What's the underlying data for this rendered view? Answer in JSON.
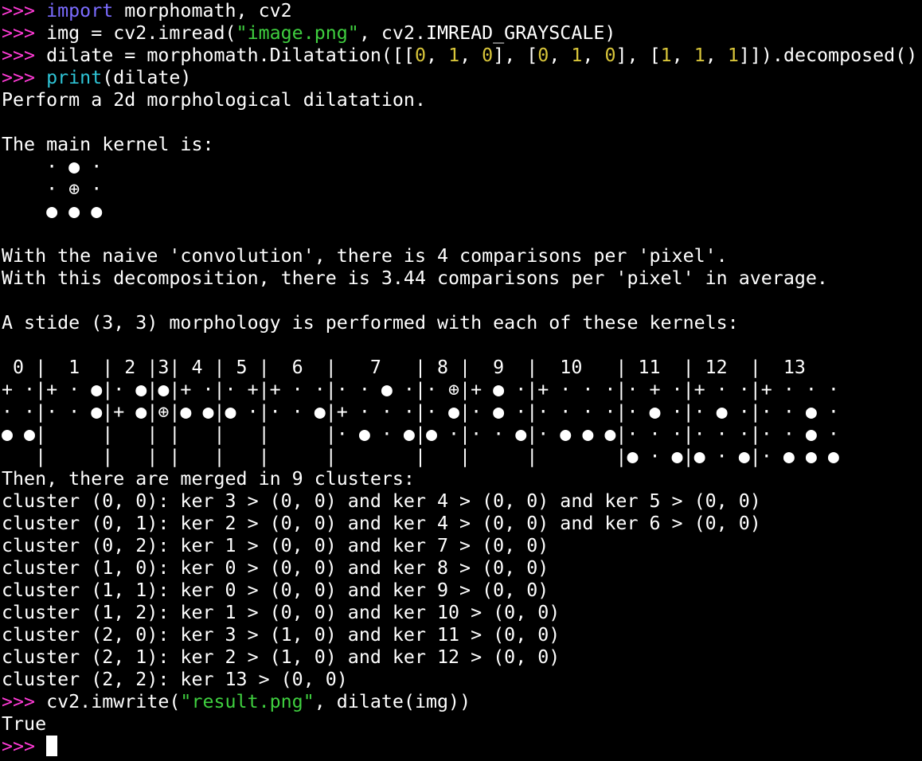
{
  "colors": {
    "background": "#000000",
    "text": "#ffffff",
    "prompt": "#ff3bd6",
    "keyword": "#7b6cff",
    "builtin": "#2ec4d6",
    "string": "#3fcf3f",
    "number": "#d8c53a"
  },
  "prompt": ">>>",
  "cmd1": {
    "kw": "import",
    "rest": " morphomath, cv2"
  },
  "cmd2": {
    "pre": " img = cv2.imread(",
    "str": "\"image.png\"",
    "post": ", cv2.IMREAD_GRAYSCALE)"
  },
  "cmd3": {
    "pre": " dilate = morphomath.Dilatation([[",
    "n1": "0",
    "s1": ", ",
    "n2": "1",
    "s2": ", ",
    "n3": "0",
    "s3": "], [",
    "n4": "0",
    "s4": ", ",
    "n5": "1",
    "s5": ", ",
    "n6": "0",
    "s6": "], [",
    "n7": "1",
    "s7": ", ",
    "n8": "1",
    "s8": ", ",
    "n9": "1",
    "post": "]]).decomposed()"
  },
  "cmd4": {
    "bi": "print",
    "rest": "(dilate)"
  },
  "out": {
    "desc": "Perform a 2d morphological dilatation.",
    "main_kernel": "The main kernel is:",
    "kernel_rows": [
      "    · ● ·",
      "    · ⊕ ·",
      "    ● ● ●"
    ],
    "naive": "With the naive 'convolution', there is 4 comparisons per 'pixel'.",
    "decomp": "With this decomposition, there is 3.44 comparisons per 'pixel' in average.",
    "stride": "A stide (3, 3) morphology is performed with each of these kernels:",
    "kernel_table": [
      " 0 |  1  | 2 |3| 4 | 5 |  6  |   7   | 8 |  9  |  10   | 11  | 12  |  13",
      "+ ·|+ · ●|· ●|●|+ ·|· +|+ · ·|· · ● ·|· ⊕|+ ● ·|+ · · ·|· + ·|+ · ·|+ · · ·",
      "· ·|· · ●|+ ●|⊕|● ●|● ·|· · ●|+ · · ·|· ●|· ● ·|· · · ·|· ● ·|· ● ·|· · ● ·",
      "● ●|     |   | |   |   |     |· ● · ●|● ·|· · ●|· ● ● ●|· · ·|· · ·|· · ● ·",
      "   |     |   | |   |   |     |       |   |     |       |● · ●|● · ●|· ● ● ●"
    ],
    "merged": "Then, there are merged in 9 clusters:",
    "clusters": [
      "cluster (0, 0): ker 3 > (0, 0) and ker 4 > (0, 0) and ker 5 > (0, 0)",
      "cluster (0, 1): ker 2 > (0, 0) and ker 4 > (0, 0) and ker 6 > (0, 0)",
      "cluster (0, 2): ker 1 > (0, 0) and ker 7 > (0, 0)",
      "cluster (1, 0): ker 0 > (0, 0) and ker 8 > (0, 0)",
      "cluster (1, 1): ker 0 > (0, 0) and ker 9 > (0, 0)",
      "cluster (1, 2): ker 1 > (0, 0) and ker 10 > (0, 0)",
      "cluster (2, 0): ker 3 > (1, 0) and ker 11 > (0, 0)",
      "cluster (2, 1): ker 2 > (1, 0) and ker 12 > (0, 0)",
      "cluster (2, 2): ker 13 > (0, 0)"
    ]
  },
  "cmd5": {
    "pre": " cv2.imwrite(",
    "str": "\"result.png\"",
    "post": ", dilate(img))"
  },
  "result": "True"
}
